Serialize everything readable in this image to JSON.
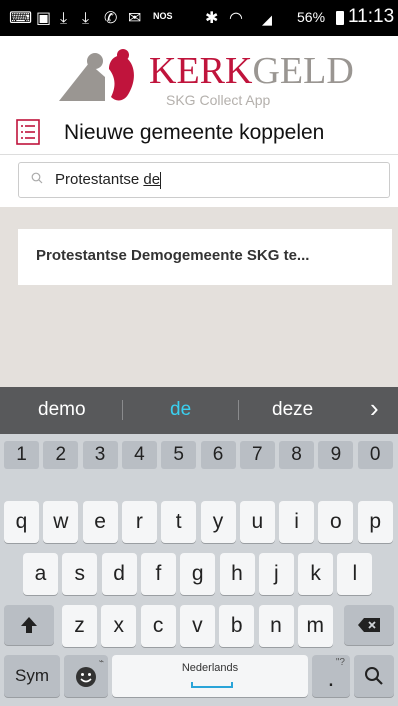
{
  "status_bar": {
    "nos": "NOS",
    "battery": "56%",
    "time": "11:13"
  },
  "logo": {
    "kerk": "KERK",
    "geld": "GELD",
    "subtitle": "SKG Collect App"
  },
  "header": {
    "title": "Nieuwe gemeente koppelen"
  },
  "search": {
    "value_plain": "Protestantse ",
    "value_underlined": "de"
  },
  "results": [
    {
      "label": "Protestantse Demogemeente SKG te..."
    }
  ],
  "keyboard": {
    "suggestions": [
      "demo",
      "de",
      "deze"
    ],
    "suggest_more": "›",
    "numbers": [
      "1",
      "2",
      "3",
      "4",
      "5",
      "6",
      "7",
      "8",
      "9",
      "0"
    ],
    "row1": [
      "q",
      "w",
      "e",
      "r",
      "t",
      "y",
      "u",
      "i",
      "o",
      "p"
    ],
    "row2": [
      "a",
      "s",
      "d",
      "f",
      "g",
      "h",
      "j",
      "k",
      "l"
    ],
    "row3": [
      "z",
      "x",
      "c",
      "v",
      "b",
      "n",
      "m"
    ],
    "sym": "Sym",
    "space_label": "Nederlands",
    "period": ".",
    "period_hint": "\"?",
    "colors": {
      "suggest_active": "#3ad0f0",
      "space_underline": "#2aa4d8"
    }
  },
  "colors": {
    "brand_red": "#c0143c",
    "brand_gray": "#9a9692"
  }
}
